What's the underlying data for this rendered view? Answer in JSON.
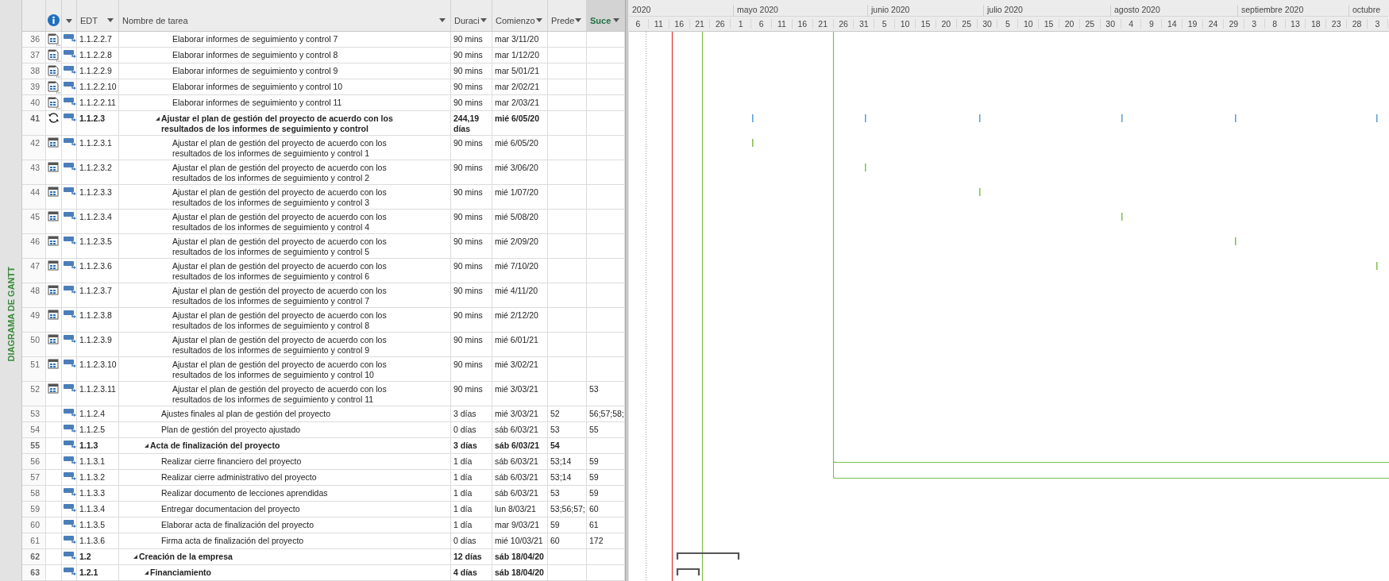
{
  "side_label": "DIAGRAMA DE GANTT",
  "columns": [
    {
      "kind": "info",
      "selected": false
    },
    {
      "kind": "mode",
      "selected": false
    },
    {
      "kind": "text",
      "label": "EDT",
      "selected": false
    },
    {
      "kind": "text",
      "label": "Nombre de tarea",
      "selected": false
    },
    {
      "kind": "text",
      "label": "Duraci",
      "selected": false
    },
    {
      "kind": "text",
      "label": "Comienzo",
      "selected": false
    },
    {
      "kind": "text",
      "label": "Prede",
      "selected": false
    },
    {
      "kind": "text",
      "label": "Suce",
      "selected": true
    }
  ],
  "timeline": {
    "months": [
      "2020",
      "mayo 2020",
      "junio 2020",
      "julio 2020",
      "agosto 2020",
      "septiembre 2020",
      "octubre"
    ],
    "days": [
      "6",
      "11",
      "16",
      "21",
      "26",
      "1",
      "6",
      "11",
      "16",
      "21",
      "26",
      "31",
      "5",
      "10",
      "15",
      "20",
      "25",
      "30",
      "5",
      "10",
      "15",
      "20",
      "25",
      "30",
      "4",
      "9",
      "14",
      "19",
      "24",
      "29",
      "3",
      "8",
      "13",
      "18",
      "23",
      "28",
      "3"
    ]
  },
  "rows": [
    {
      "id": "36",
      "kind": "task",
      "indicator": {
        "kind": "calendar_note"
      },
      "edt": "1.1.2.2.7",
      "name": "Elaborar informes de seguimiento y control 7",
      "duration": "90 mins",
      "start": "mar 3/11/20"
    },
    {
      "id": "37",
      "kind": "task",
      "indicator": {
        "kind": "calendar_note"
      },
      "edt": "1.1.2.2.8",
      "name": "Elaborar informes de seguimiento y control 8",
      "duration": "90 mins",
      "start": "mar 1/12/20"
    },
    {
      "id": "38",
      "kind": "task",
      "indicator": {
        "kind": "calendar_note"
      },
      "edt": "1.1.2.2.9",
      "name": "Elaborar informes de seguimiento y control 9",
      "duration": "90 mins",
      "start": "mar 5/01/21"
    },
    {
      "id": "39",
      "kind": "task",
      "indicator": {
        "kind": "calendar_note"
      },
      "edt": "1.1.2.2.10",
      "name": "Elaborar informes de seguimiento y control 10",
      "duration": "90 mins",
      "start": "mar 2/02/21"
    },
    {
      "id": "40",
      "kind": "task",
      "indicator": {
        "kind": "calendar_note"
      },
      "edt": "1.1.2.2.11",
      "name": "Elaborar informes de seguimiento y control 11",
      "duration": "90 mins",
      "start": "mar 2/03/21"
    },
    {
      "id": "41",
      "kind": "summary",
      "expanded": true,
      "indicator": {
        "kind": "recurring"
      },
      "edt": "1.1.2.3",
      "name": "Ajustar el plan de gestión del proyecto de acuerdo con los resultados de los informes de seguimiento y control",
      "duration": "244,19 días",
      "start": "mié 6/05/20",
      "children": [
        {
          "id": "42",
          "kind": "task",
          "indicator": {
            "kind": "calendar"
          },
          "edt": "1.1.2.3.1",
          "name": "Ajustar el plan de gestión del proyecto de acuerdo con los resultados de los informes de seguimiento y control 1",
          "duration": "90 mins",
          "start": "mié 6/05/20"
        },
        {
          "id": "43",
          "kind": "task",
          "indicator": {
            "kind": "calendar"
          },
          "edt": "1.1.2.3.2",
          "name": "Ajustar el plan de gestión del proyecto de acuerdo con los resultados de los informes de seguimiento y control 2",
          "duration": "90 mins",
          "start": "mié 3/06/20"
        },
        {
          "id": "44",
          "kind": "task",
          "indicator": {
            "kind": "calendar"
          },
          "edt": "1.1.2.3.3",
          "name": "Ajustar el plan de gestión del proyecto de acuerdo con los resultados de los informes de seguimiento y control 3",
          "duration": "90 mins",
          "start": "mié 1/07/20"
        },
        {
          "id": "45",
          "kind": "task",
          "indicator": {
            "kind": "calendar"
          },
          "edt": "1.1.2.3.4",
          "name": "Ajustar el plan de gestión del proyecto de acuerdo con los resultados de los informes de seguimiento y control 4",
          "duration": "90 mins",
          "start": "mié 5/08/20"
        },
        {
          "id": "46",
          "kind": "task",
          "indicator": {
            "kind": "calendar"
          },
          "edt": "1.1.2.3.5",
          "name": "Ajustar el plan de gestión del proyecto de acuerdo con los resultados de los informes de seguimiento y control 5",
          "duration": "90 mins",
          "start": "mié 2/09/20"
        },
        {
          "id": "47",
          "kind": "task",
          "indicator": {
            "kind": "calendar"
          },
          "edt": "1.1.2.3.6",
          "name": "Ajustar el plan de gestión del proyecto de acuerdo con los resultados de los informes de seguimiento y control 6",
          "duration": "90 mins",
          "start": "mié 7/10/20"
        },
        {
          "id": "48",
          "kind": "task",
          "indicator": {
            "kind": "calendar"
          },
          "edt": "1.1.2.3.7",
          "name": "Ajustar el plan de gestión del proyecto de acuerdo con los resultados de los informes de seguimiento y control 7",
          "duration": "90 mins",
          "start": "mié 4/11/20"
        },
        {
          "id": "49",
          "kind": "task",
          "indicator": {
            "kind": "calendar"
          },
          "edt": "1.1.2.3.8",
          "name": "Ajustar el plan de gestión del proyecto de acuerdo con los resultados de los informes de seguimiento y control 8",
          "duration": "90 mins",
          "start": "mié 2/12/20"
        },
        {
          "id": "50",
          "kind": "task",
          "indicator": {
            "kind": "calendar"
          },
          "edt": "1.1.2.3.9",
          "name": "Ajustar el plan de gestión del proyecto de acuerdo con los resultados de los informes de seguimiento y control 9",
          "duration": "90 mins",
          "start": "mié 6/01/21"
        },
        {
          "id": "51",
          "kind": "task",
          "indicator": {
            "kind": "calendar"
          },
          "edt": "1.1.2.3.10",
          "name": "Ajustar el plan de gestión del proyecto de acuerdo con los resultados de los informes de seguimiento y control 10",
          "duration": "90 mins",
          "start": "mié 3/02/21"
        },
        {
          "id": "52",
          "kind": "task",
          "indicator": {
            "kind": "calendar"
          },
          "edt": "1.1.2.3.11",
          "name": "Ajustar el plan de gestión del proyecto de acuerdo con los resultados de los informes de seguimiento y control 11",
          "duration": "90 mins",
          "start": "mié 3/03/21",
          "successors": "53"
        }
      ]
    },
    {
      "id": "53",
      "kind": "task",
      "edt": "1.1.2.4",
      "name": "Ajustes finales al plan de gestión del proyecto",
      "duration": "3 días",
      "start": "mié 3/03/21",
      "predecessors": "52",
      "successors": "56;57;58;"
    },
    {
      "id": "54",
      "kind": "task",
      "edt": "1.1.2.5",
      "name": "Plan de gestión del proyecto ajustado",
      "duration": "0 días",
      "start": "sáb 6/03/21",
      "predecessors": "53",
      "successors": "55"
    },
    {
      "id": "55",
      "kind": "summary",
      "expanded": true,
      "edt": "1.1.3",
      "name": "Acta de finalización del proyecto",
      "duration": "3 días",
      "start": "sáb 6/03/21",
      "predecessors": "54",
      "children": [
        {
          "id": "56",
          "kind": "task",
          "edt": "1.1.3.1",
          "name": "Realizar cierre financiero del proyecto",
          "duration": "1 día",
          "start": "sáb 6/03/21",
          "predecessors": "53;14",
          "successors": "59"
        },
        {
          "id": "57",
          "kind": "task",
          "edt": "1.1.3.2",
          "name": "Realizar cierre administrativo del proyecto",
          "duration": "1 día",
          "start": "sáb 6/03/21",
          "predecessors": "53;14",
          "successors": "59"
        },
        {
          "id": "58",
          "kind": "task",
          "edt": "1.1.3.3",
          "name": "Realizar documento de lecciones aprendidas",
          "duration": "1 día",
          "start": "sáb 6/03/21",
          "predecessors": "53",
          "successors": "59"
        },
        {
          "id": "59",
          "kind": "task",
          "edt": "1.1.3.4",
          "name": "Entregar documentacion del proyecto",
          "duration": "1 día",
          "start": "lun 8/03/21",
          "predecessors": "53;56;57;",
          "successors": "60"
        },
        {
          "id": "60",
          "kind": "task",
          "edt": "1.1.3.5",
          "name": "Elaborar acta de finalización del proyecto",
          "duration": "1 día",
          "start": "mar 9/03/21",
          "predecessors": "59",
          "successors": "61"
        },
        {
          "id": "61",
          "kind": "task",
          "edt": "1.1.3.6",
          "name": "Firma acta de finalización del proyecto",
          "duration": "0 días",
          "start": "mié 10/03/21",
          "predecessors": "60",
          "successors": "172"
        }
      ]
    },
    {
      "id": "62",
      "kind": "summary",
      "expanded": true,
      "edt": "1.2",
      "name": "Creación de la empresa",
      "duration": "12 días",
      "start": "sáb 18/04/20",
      "children": [
        {
          "id": "63",
          "kind": "summary",
          "expanded": true,
          "edt": "1.2.1",
          "name": "Financiamiento",
          "duration": "4 días",
          "start": "sáb 18/04/20"
        }
      ]
    }
  ]
}
